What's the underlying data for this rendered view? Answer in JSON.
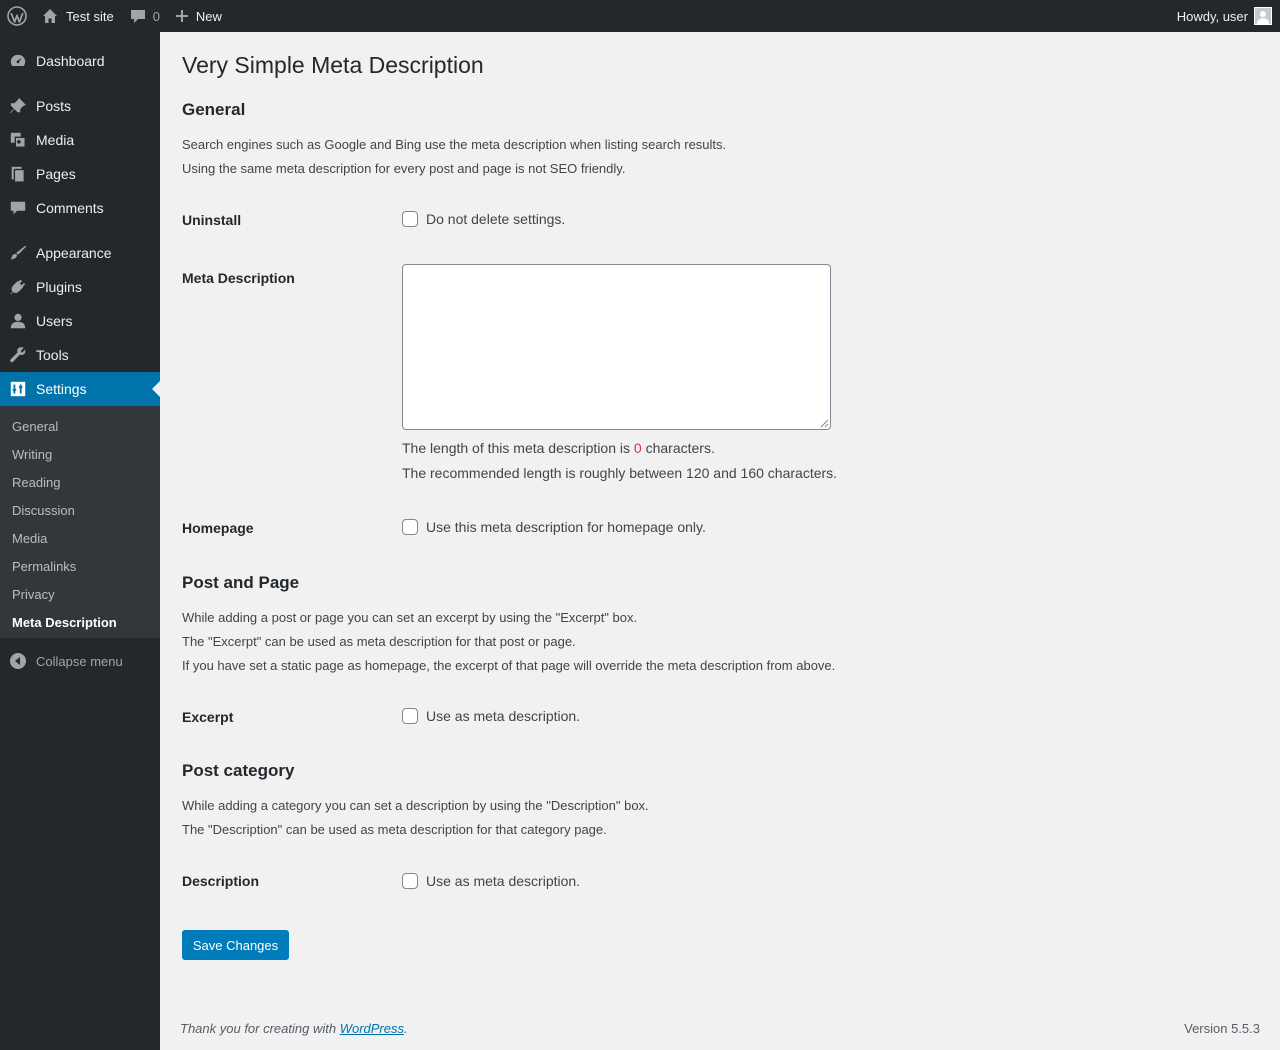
{
  "adminbar": {
    "site_name": "Test site",
    "comments_count": "0",
    "new_label": "New",
    "howdy": "Howdy, user"
  },
  "sidebar": {
    "items": [
      {
        "label": "Dashboard",
        "icon": "dashboard-icon"
      },
      {
        "label": "Posts",
        "icon": "pin-icon"
      },
      {
        "label": "Media",
        "icon": "media-icon"
      },
      {
        "label": "Pages",
        "icon": "pages-icon"
      },
      {
        "label": "Comments",
        "icon": "comment-icon"
      },
      {
        "label": "Appearance",
        "icon": "brush-icon"
      },
      {
        "label": "Plugins",
        "icon": "plug-icon"
      },
      {
        "label": "Users",
        "icon": "user-icon"
      },
      {
        "label": "Tools",
        "icon": "wrench-icon"
      },
      {
        "label": "Settings",
        "icon": "settings-icon"
      }
    ],
    "submenu": [
      "General",
      "Writing",
      "Reading",
      "Discussion",
      "Media",
      "Permalinks",
      "Privacy",
      "Meta Description"
    ],
    "collapse": "Collapse menu"
  },
  "main": {
    "title": "Very Simple Meta Description",
    "general": {
      "heading": "General",
      "desc1": "Search engines such as Google and Bing use the meta description when listing search results.",
      "desc2": "Using the same meta description for every post and page is not SEO friendly."
    },
    "uninstall": {
      "label": "Uninstall",
      "checkbox": "Do not delete settings.",
      "checked": false
    },
    "meta": {
      "label": "Meta Description",
      "value": "",
      "length_prefix": "The length of this meta description is",
      "length_value": "0",
      "length_suffix": "characters.",
      "recommended": "The recommended length is roughly between 120 and 160 characters."
    },
    "homepage": {
      "label": "Homepage",
      "checkbox": "Use this meta description for homepage only.",
      "checked": false
    },
    "post_page": {
      "heading": "Post and Page",
      "desc1": "While adding a post or page you can set an excerpt by using the \"Excerpt\" box.",
      "desc2": "The \"Excerpt\" can be used as meta description for that post or page.",
      "desc3": "If you have set a static page as homepage, the excerpt of that page will override the meta description from above."
    },
    "excerpt": {
      "label": "Excerpt",
      "checkbox": "Use as meta description.",
      "checked": false
    },
    "post_category": {
      "heading": "Post category",
      "desc1": "While adding a category you can set a description by using the \"Description\" box.",
      "desc2": "The \"Description\" can be used as meta description for that category page."
    },
    "description": {
      "label": "Description",
      "checkbox": "Use as meta description.",
      "checked": false
    },
    "save_label": "Save Changes"
  },
  "footer": {
    "thanks_prefix": "Thank you for creating with",
    "wp_link": "WordPress",
    "thanks_suffix": ".",
    "version": "Version 5.5.3"
  },
  "colors": {
    "adminbar_bg": "#23282d",
    "accent": "#0073aa",
    "button": "#007cba",
    "count_red": "#dc3232",
    "page_bg": "#f1f1f1"
  }
}
